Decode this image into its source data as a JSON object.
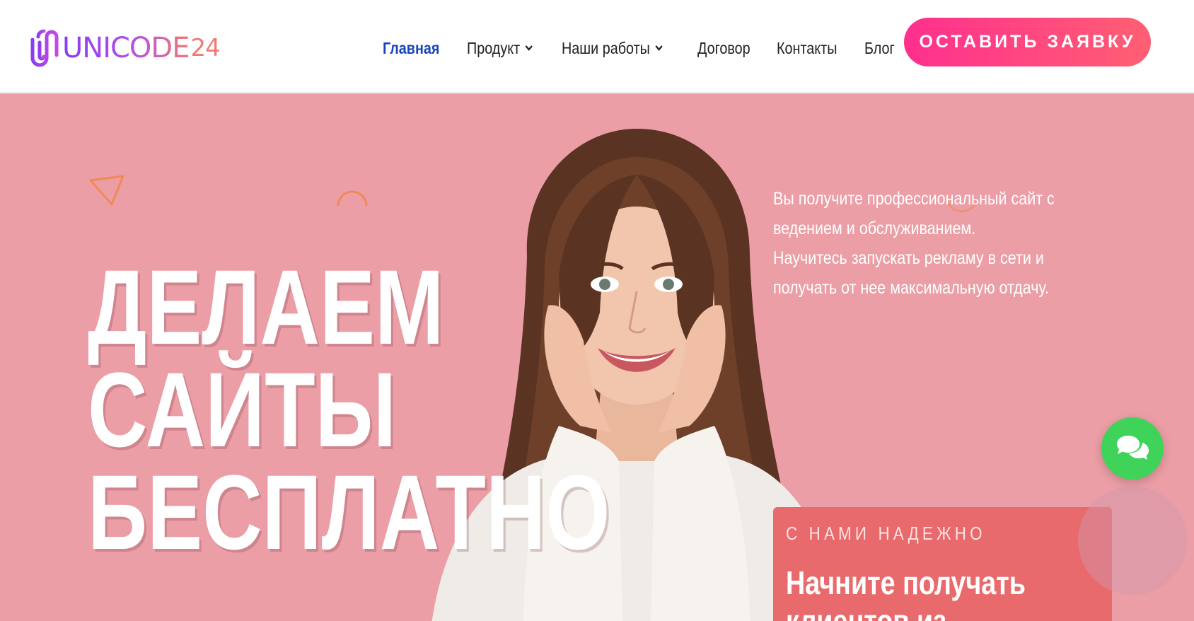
{
  "brand": {
    "name": "UNICODE",
    "number": "24",
    "logo_icon": "paperclip-logo-icon",
    "colors": {
      "purple": "#8b3cf0",
      "coral": "#f07a73"
    }
  },
  "nav": {
    "items": [
      {
        "label": "Главная",
        "active": true
      },
      {
        "label": "Продукт",
        "dropdown": true
      },
      {
        "label": "Наши работы",
        "dropdown": true
      },
      {
        "label": "Договор"
      },
      {
        "label": "Контакты"
      },
      {
        "label": "Блог"
      }
    ],
    "active_color": "#1846b8"
  },
  "cta": {
    "label": "ОСТАВИТЬ ЗАЯВКУ",
    "gradient": [
      "#ff2f8e",
      "#ff5f73"
    ]
  },
  "hero": {
    "background": "#ec9ea6",
    "headline": [
      "ДЕЛАЕМ",
      "САЙТЫ",
      "БЕСПЛАТНО"
    ],
    "intro_lines": [
      "Вы получите профессиональный сайт с",
      "ведением и обслуживанием.",
      "Научитесь запускать рекламу в сети и",
      "получать от нее максимальную отдачу."
    ],
    "card": {
      "kicker": "С НАМИ НАДЕЖНО",
      "title_lines": [
        "Начните получать",
        "клиентов из"
      ],
      "background": "#e86a6c"
    },
    "close_icon": "close-icon",
    "chat_icon": "chat-bubbles-icon",
    "chat_color": "#3fd35a"
  }
}
